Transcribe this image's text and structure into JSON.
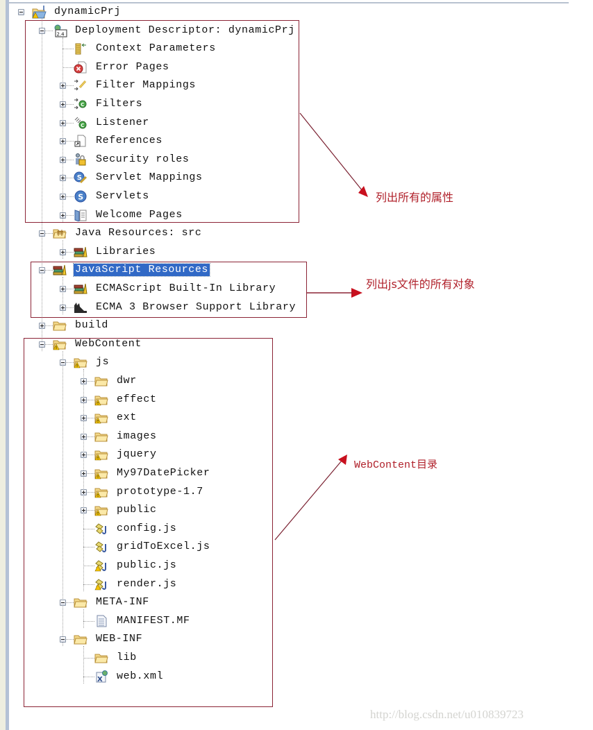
{
  "tree": {
    "root": {
      "label": "dynamicPrj",
      "icon": "web-project-icon",
      "expanded": true
    },
    "items": [
      {
        "label": "Deployment Descriptor: dynamicPrj",
        "icon": "deployment-descriptor-icon",
        "level": 1,
        "toggle": "minus"
      },
      {
        "label": "Context Parameters",
        "icon": "context-parameters-icon",
        "level": 2,
        "toggle": "none"
      },
      {
        "label": "Error Pages",
        "icon": "error-pages-icon",
        "level": 2,
        "toggle": "none"
      },
      {
        "label": "Filter Mappings",
        "icon": "filter-mappings-icon",
        "level": 2,
        "toggle": "plus"
      },
      {
        "label": "Filters",
        "icon": "filters-icon",
        "level": 2,
        "toggle": "plus"
      },
      {
        "label": "Listener",
        "icon": "listener-icon",
        "level": 2,
        "toggle": "plus"
      },
      {
        "label": "References",
        "icon": "references-icon",
        "level": 2,
        "toggle": "plus"
      },
      {
        "label": "Security roles",
        "icon": "security-roles-icon",
        "level": 2,
        "toggle": "plus"
      },
      {
        "label": "Servlet Mappings",
        "icon": "servlet-mappings-icon",
        "level": 2,
        "toggle": "plus"
      },
      {
        "label": "Servlets",
        "icon": "servlets-icon",
        "level": 2,
        "toggle": "plus"
      },
      {
        "label": "Welcome Pages",
        "icon": "welcome-pages-icon",
        "level": 2,
        "toggle": "plus"
      },
      {
        "label": "Java Resources: src",
        "icon": "java-resources-icon",
        "level": 1,
        "toggle": "minus"
      },
      {
        "label": "Libraries",
        "icon": "libraries-icon",
        "level": 2,
        "toggle": "plus"
      },
      {
        "label": "JavaScript Resources",
        "icon": "javascript-resources-icon",
        "level": 1,
        "toggle": "minus",
        "selected": true
      },
      {
        "label": "ECMAScript Built-In Library",
        "icon": "library-icon",
        "level": 2,
        "toggle": "plus"
      },
      {
        "label": "ECMA 3 Browser Support Library",
        "icon": "browser-library-icon",
        "level": 2,
        "toggle": "plus"
      },
      {
        "label": "build",
        "icon": "folder-icon",
        "level": 1,
        "toggle": "plus"
      },
      {
        "label": "WebContent",
        "icon": "folder-warning-icon",
        "level": 1,
        "toggle": "minus"
      },
      {
        "label": "js",
        "icon": "folder-warning-icon",
        "level": 2,
        "toggle": "minus"
      },
      {
        "label": "dwr",
        "icon": "folder-icon",
        "level": 3,
        "toggle": "plus"
      },
      {
        "label": "effect",
        "icon": "folder-warning-icon",
        "level": 3,
        "toggle": "plus"
      },
      {
        "label": "ext",
        "icon": "folder-warning-icon",
        "level": 3,
        "toggle": "plus"
      },
      {
        "label": "images",
        "icon": "folder-icon",
        "level": 3,
        "toggle": "plus"
      },
      {
        "label": "jquery",
        "icon": "folder-warning-icon",
        "level": 3,
        "toggle": "plus"
      },
      {
        "label": "My97DatePicker",
        "icon": "folder-warning-icon",
        "level": 3,
        "toggle": "plus"
      },
      {
        "label": "prototype-1.7",
        "icon": "folder-warning-icon",
        "level": 3,
        "toggle": "plus"
      },
      {
        "label": "public",
        "icon": "folder-warning-icon",
        "level": 3,
        "toggle": "plus"
      },
      {
        "label": "config.js",
        "icon": "js-file-icon",
        "level": 3,
        "toggle": "none"
      },
      {
        "label": "gridToExcel.js",
        "icon": "js-file-icon",
        "level": 3,
        "toggle": "none"
      },
      {
        "label": "public.js",
        "icon": "js-file-warning-icon",
        "level": 3,
        "toggle": "none"
      },
      {
        "label": "render.js",
        "icon": "js-file-warning-icon",
        "level": 3,
        "toggle": "none"
      },
      {
        "label": "META-INF",
        "icon": "folder-icon",
        "level": 2,
        "toggle": "minus"
      },
      {
        "label": "MANIFEST.MF",
        "icon": "text-file-icon",
        "level": 3,
        "toggle": "none"
      },
      {
        "label": "WEB-INF",
        "icon": "folder-icon",
        "level": 2,
        "toggle": "minus"
      },
      {
        "label": "lib",
        "icon": "folder-icon",
        "level": 3,
        "toggle": "none"
      },
      {
        "label": "web.xml",
        "icon": "xml-file-icon",
        "level": 3,
        "toggle": "none"
      }
    ]
  },
  "annotations": {
    "properties": "列出所有的属性",
    "js_objects": "列出js文件的所有对象",
    "webcontent": "WebContent目录"
  },
  "colors": {
    "annotation_red": "#b0202a",
    "box_border": "#8b2335",
    "selection": "#3169c6"
  },
  "watermark": "http://blog.csdn.net/u010839723"
}
